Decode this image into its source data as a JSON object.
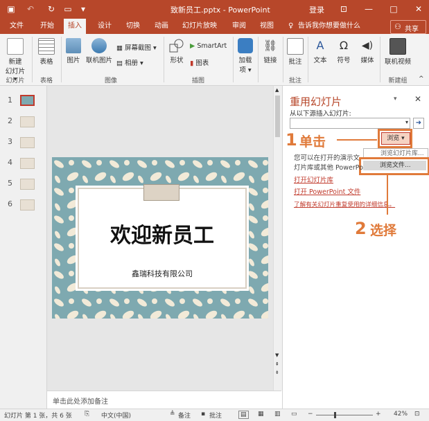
{
  "titlebar": {
    "doc_title": "致新员工.pptx - PowerPoint",
    "signin": "登录",
    "minimize": "—",
    "restore": "□",
    "close": "✕"
  },
  "tabs": [
    "文件",
    "开始",
    "插入",
    "设计",
    "切换",
    "动画",
    "幻灯片放映",
    "审阅",
    "视图"
  ],
  "tell_me": "告诉我你想要做什么",
  "share": "共享",
  "ribbon": {
    "new_slide": "新建\n幻灯片",
    "new_slide_l1": "新建",
    "new_slide_l2": "幻灯片 ▾",
    "table": "表格",
    "picture": "图片",
    "online_picture": "联机图片",
    "screenshot": "屏幕截图 ▾",
    "album": "相册 ▾",
    "shapes": "形状",
    "smartart": "SmartArt",
    "chart": "图表",
    "addins_l1": "加载",
    "addins_l2": "项 ▾",
    "link": "链接",
    "comment": "批注",
    "text": "文本",
    "symbol": "符号",
    "media": "媒体",
    "online_video": "联机视频",
    "groups": {
      "slides": "幻灯片",
      "tables": "表格",
      "images": "图像",
      "illustrations": "插图",
      "comments": "批注",
      "newgroup": "新建组"
    }
  },
  "thumbs": [
    "1",
    "2",
    "3",
    "4",
    "5",
    "6"
  ],
  "slide": {
    "title": "欢迎新员工",
    "company": "鑫瑞科技有限公司"
  },
  "notes_placeholder": "单击此处添加备注",
  "pane": {
    "title": "重用幻灯片",
    "close": "✕",
    "subtitle": "从以下源插入幻灯片:",
    "browse": "浏览",
    "desc_l1": "您可以在打开的演示文",
    "desc_l2": "灯片库或其他 PowerPo",
    "menu_item1": "浏览幻灯片库...",
    "menu_item2": "浏览文件...",
    "link1": "打开幻灯片库",
    "link2": "打开 PowerPoint 文件",
    "link3": "了解有关幻灯片重复使用的详细信息。"
  },
  "callouts": {
    "step1_num": "1",
    "step1_text": "单击",
    "step2_num": "2",
    "step2_text": "选择"
  },
  "status": {
    "slide_info": "幻灯片 第 1 张，共 6 张",
    "language": "中文(中国)",
    "notes": "备注",
    "comments": "批注",
    "zoom": "42%"
  },
  "colors": {
    "accent": "#b7472a",
    "callout": "#e07a3a"
  }
}
